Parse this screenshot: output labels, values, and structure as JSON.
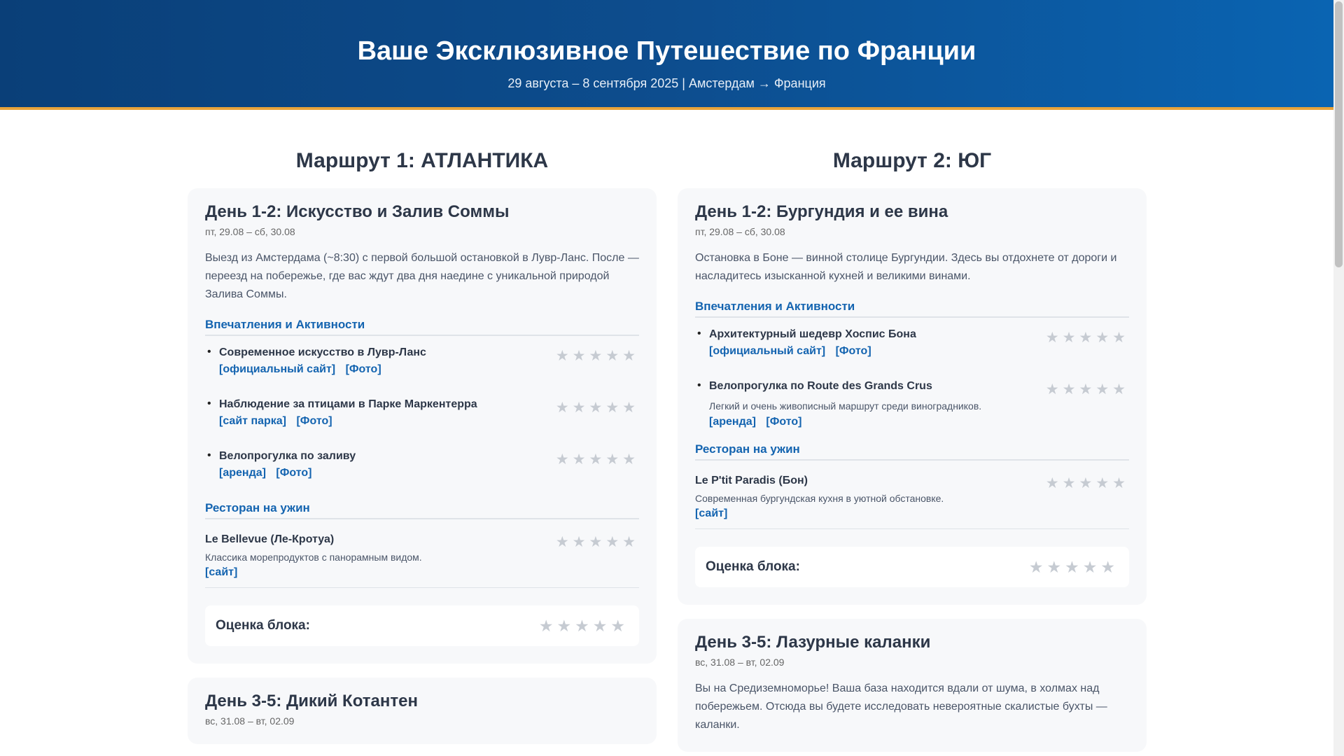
{
  "header": {
    "title": "Ваше Эксклюзивное Путешествие по Франции",
    "subtitle": "29 августа – 8 сентября 2025 | Амстердам → Франция"
  },
  "routes": [
    {
      "title": "Маршрут 1: АТЛАНТИКА",
      "day1": {
        "title": "День 1-2: Искусство и Залив Соммы",
        "dates": "пт, 29.08 – сб, 30.08",
        "intro": "Выезд из Амстердама (~8:30) с первой большой остановкой в Лувр-Ланс. После — переезд на побережье, где вас ждут два дня наедине с уникальной природой Залива Соммы.",
        "activities_title": "Впечатления и Активности",
        "activities": [
          {
            "name": "Современное искусство в Лувр-Ланс",
            "links": [
              "[официальный сайт]",
              "[Фото]"
            ]
          },
          {
            "name": "Наблюдение за птицами в Парке Маркентерра",
            "links": [
              "[сайт парка]",
              "[Фото]"
            ]
          },
          {
            "name": "Велопрогулка по заливу",
            "links": [
              "[аренда]",
              "[Фото]"
            ]
          }
        ],
        "restaurant_title": "Ресторан на ужин",
        "restaurant": {
          "name": "Le Bellevue (Ле-Кротуа)",
          "desc": "Классика морепродуктов с панорамным видом.",
          "link": "[сайт]"
        },
        "rating_label": "Оценка блока:"
      },
      "day2": {
        "title": "День 3-5: Дикий Котантен",
        "dates": "вс, 31.08 – вт, 02.09"
      }
    },
    {
      "title": "Маршрут 2: ЮГ",
      "day1": {
        "title": "День 1-2: Бургундия и ее вина",
        "dates": "пт, 29.08 – сб, 30.08",
        "intro": "Остановка в Боне — винной столице Бургундии. Здесь вы отдохнете от дороги и насладитесь изысканной кухней и великими винами.",
        "activities_title": "Впечатления и Активности",
        "activities": [
          {
            "name": "Архитектурный шедевр Хоспис Бона",
            "links": [
              "[официальный сайт]",
              "[Фото]"
            ]
          },
          {
            "name": "Велопрогулка по Route des Grands Crus",
            "desc": "Легкий и очень живописный маршрут среди виноградников.",
            "links": [
              "[аренда]",
              "[Фото]"
            ]
          }
        ],
        "restaurant_title": "Ресторан на ужин",
        "restaurant": {
          "name": "Le P'tit Paradis (Бон)",
          "desc": "Современная бургундская кухня в уютной обстановке.",
          "link": "[сайт]"
        },
        "rating_label": "Оценка блока:"
      },
      "day2": {
        "title": "День 3-5: Лазурные каланки",
        "dates": "вс, 31.08 – вт, 02.09",
        "intro": "Вы на Средиземноморье! Ваша база находится вдали от шума, в холмах над побережьем. Отсюда вы будете исследовать невероятные скалистые бухты — каланки."
      }
    }
  ],
  "stars": "★★★★★",
  "colors": {
    "accent": "#1464b0",
    "header_border": "#e8a33a",
    "star_empty": "#c6cbd2"
  }
}
